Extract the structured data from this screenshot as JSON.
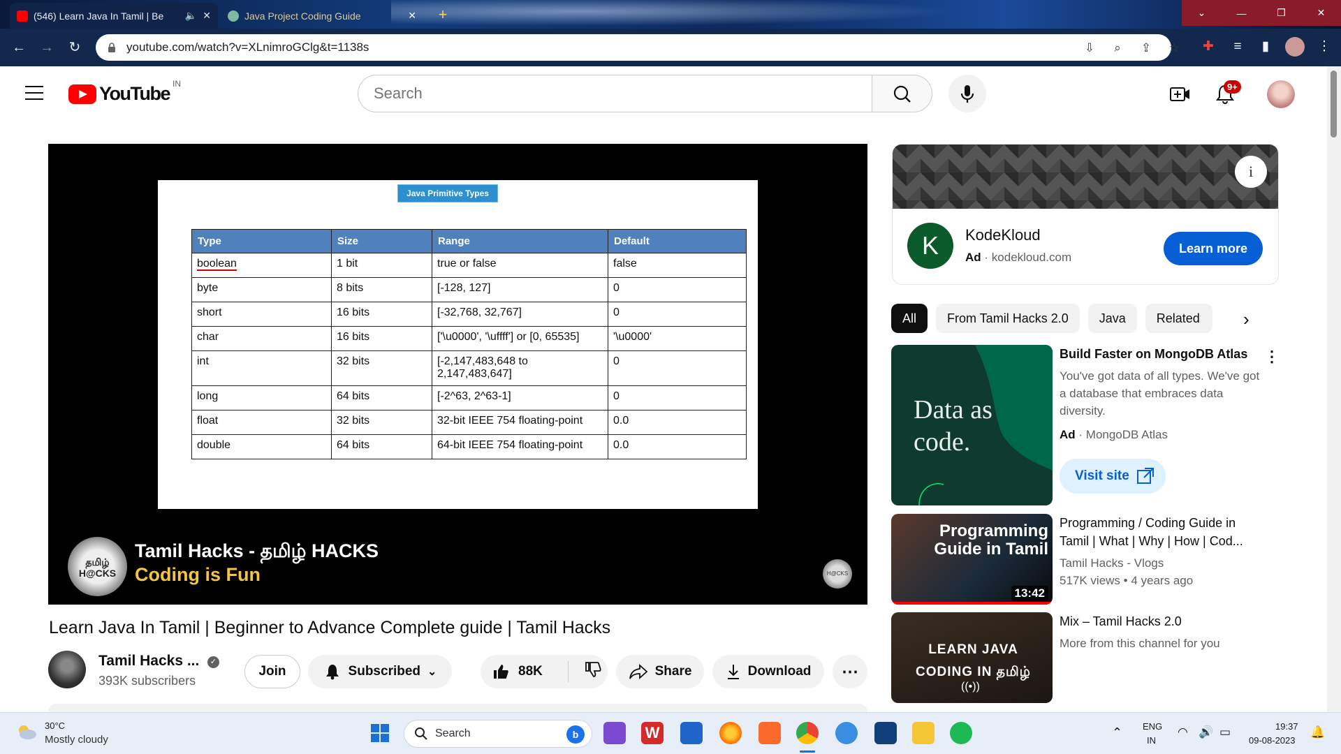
{
  "browser": {
    "tabs": [
      {
        "title": "(546) Learn Java In Tamil | Be",
        "active": true
      },
      {
        "title": "Java Project Coding Guide",
        "active": false
      }
    ],
    "url": "youtube.com/watch?v=XLnimroGClg&t=1138s"
  },
  "header": {
    "logo_text": "YouTube",
    "country": "IN",
    "search_placeholder": "Search",
    "notifications_badge": "9+"
  },
  "video": {
    "slide_title": "Java Primitive Types",
    "table": {
      "columns": [
        "Type",
        "Size",
        "Range",
        "Default"
      ],
      "rows": [
        [
          "boolean",
          "1 bit",
          "true or false",
          "false"
        ],
        [
          "byte",
          "8 bits",
          "[-128, 127]",
          "0"
        ],
        [
          "short",
          "16 bits",
          "[-32,768, 32,767]",
          "0"
        ],
        [
          "char",
          "16 bits",
          "['\\u0000', '\\uffff'] or [0, 65535]",
          "'\\u0000'"
        ],
        [
          "int",
          "32 bits",
          "[-2,147,483,648 to 2,147,483,647]",
          "0"
        ],
        [
          "long",
          "64 bits",
          "[-2^63, 2^63-1]",
          "0"
        ],
        [
          "float",
          "32 bits",
          "32-bit IEEE 754 floating-point",
          "0.0"
        ],
        [
          "double",
          "64 bits",
          "64-bit IEEE 754 floating-point",
          "0.0"
        ]
      ]
    },
    "watermark_title": "Tamil Hacks - தமிழ் HACKS",
    "watermark_sub": "Coding is Fun",
    "badge_text": "தமிழ் H@CKS",
    "title": "Learn Java In Tamil | Beginner to Advance Complete guide | Tamil Hacks",
    "channel": "Tamil Hacks ...",
    "subscribers": "393K subscribers",
    "join": "Join",
    "subscribed": "Subscribed",
    "likes": "88K",
    "share": "Share",
    "download": "Download"
  },
  "ad": {
    "logo_letter": "K",
    "name": "KodeKloud",
    "label": "Ad",
    "domain": "kodekloud.com",
    "cta": "Learn more"
  },
  "chips": [
    "All",
    "From Tamil Hacks 2.0",
    "Java",
    "Related"
  ],
  "recommendations": [
    {
      "title": "Build Faster on MongoDB Atlas",
      "desc": "You've got data of all types. We've got a database that embraces data diversity.",
      "label": "Ad",
      "advertiser": "MongoDB Atlas",
      "cta": "Visit site",
      "thumb_text": "Data as code."
    },
    {
      "title": "Programming / Coding Guide in Tamil | What | Why | How | Cod...",
      "channel": "Tamil Hacks - Vlogs",
      "views": "517K views",
      "age": "4 years ago",
      "duration": "13:42",
      "thumb_text": "Programming Guide in Tamil"
    },
    {
      "title": "Mix – Tamil Hacks 2.0",
      "subtitle": "More from this channel for you",
      "thumb_text": "LEARN JAVA CODING IN தமிழ்"
    }
  ],
  "taskbar": {
    "temperature": "30°C",
    "weather": "Mostly cloudy",
    "search": "Search",
    "lang1": "ENG",
    "lang2": "IN",
    "time": "19:37",
    "date": "09-08-2023"
  }
}
